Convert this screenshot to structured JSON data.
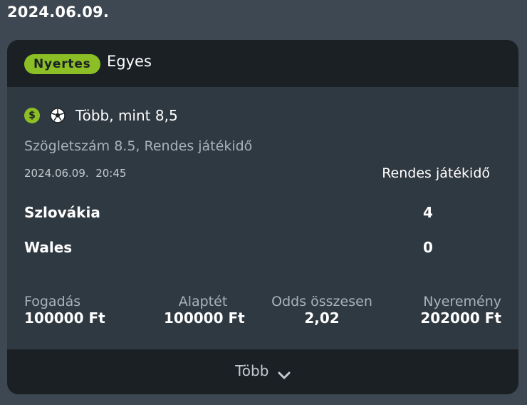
{
  "date_heading": "2024.06.09.",
  "card": {
    "status_badge": "Nyertes",
    "bet_type": "Egyes",
    "selection": "Több, mint 8,5",
    "market": "Szögletszám 8.5, Rendes játékidő",
    "event_datetime": "2024.06.09.  20:45",
    "period_label": "Rendes játékidő",
    "teams": [
      {
        "name": "Szlovákia",
        "score": "4"
      },
      {
        "name": "Wales",
        "score": "0"
      }
    ],
    "stats": {
      "stake": {
        "label": "Fogadás",
        "value": "100000 Ft"
      },
      "base_stake": {
        "label": "Alaptét",
        "value": "100000 Ft"
      },
      "total_odds": {
        "label": "Odds összesen",
        "value": "2,02"
      },
      "winnings": {
        "label": "Nyeremény",
        "value": "202000 Ft"
      }
    },
    "more_label": "Több",
    "icons": {
      "dollar_glyph": "$"
    }
  },
  "colors": {
    "page_bg": "#3d4852",
    "card_bg": "#2f3941",
    "header_bg": "#1b2025",
    "accent_green": "#8cbf26",
    "muted_text": "#a8b2bb"
  }
}
